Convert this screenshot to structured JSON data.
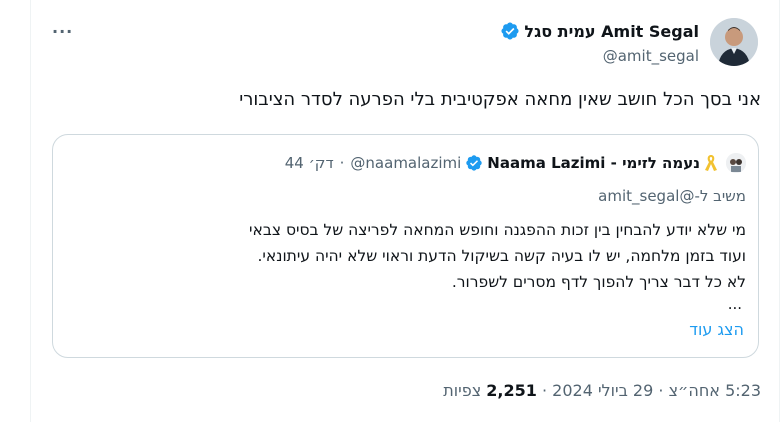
{
  "tweet": {
    "author_name": "עמית סגל Amit Segal",
    "author_handle": "@amit_segal",
    "text": "אני בסך הכל חושב שאין מחאה אפקטיבית בלי הפרעה לסדר הציבורי",
    "more_label": "···",
    "time": "5:23 אחה״צ",
    "date": "29 ביולי 2024",
    "views_count": "2,251",
    "views_label": "צפיות",
    "separator": "·"
  },
  "quote": {
    "author_name": "Naama Lazimi - נעמה לזימי",
    "author_handle": "@naamalazimi",
    "time": "44 דק׳",
    "separator": "·",
    "reply_to": "משיב ל-@amit_segal",
    "lines": [
      "מי שלא יודע להבחין בין זכות ההפגנה וחופש המחאה לפריצה של בסיס צבאי",
      "ועוד בזמן מלחמה, יש לו בעיה קשה בשיקול הדעת וראוי שלא יהיה עיתונאי.",
      "לא כל דבר צריך להפוך לדף מסרים לשפרור."
    ],
    "ellipsis": "...",
    "show_more": "הצג עוד"
  },
  "colors": {
    "accent": "#1d9bf0",
    "text": "#0f1419",
    "secondary": "#536471",
    "border": "#cfd9de",
    "ribbon": "#f2c230"
  },
  "icons": [
    "verified-badge-icon",
    "yellow-ribbon-icon",
    "more-icon"
  ]
}
